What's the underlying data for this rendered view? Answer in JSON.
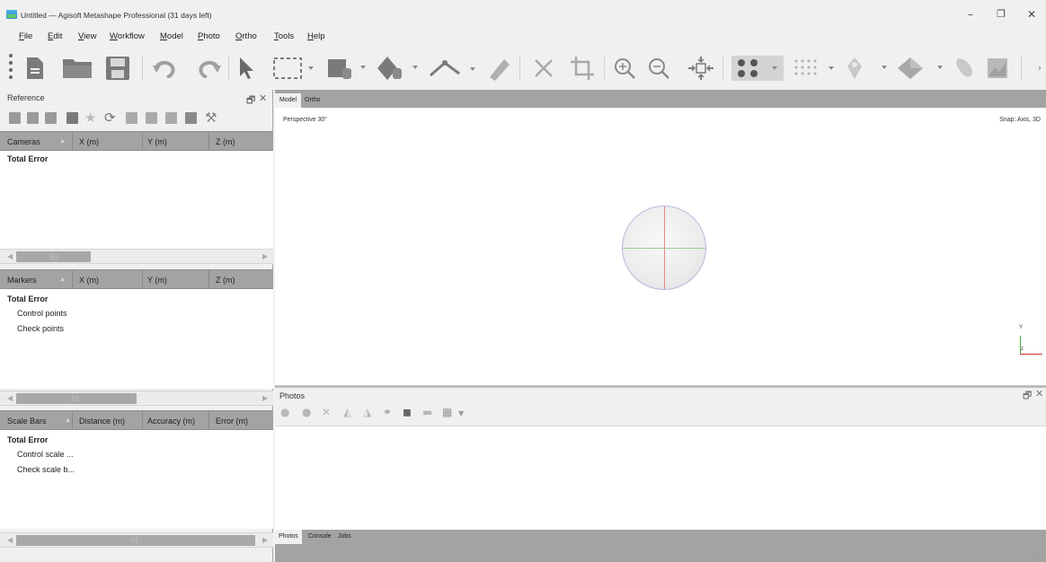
{
  "window": {
    "title": "Untitled — Agisoft Metashape Professional (31 days left)",
    "minimize": "–",
    "maximize": "❐",
    "close": "✕"
  },
  "menu": [
    {
      "label": "File",
      "key": "F",
      "rest": "ile"
    },
    {
      "label": "Edit",
      "key": "E",
      "rest": "dit"
    },
    {
      "label": "View",
      "key": "V",
      "rest": "iew"
    },
    {
      "label": "Workflow",
      "key": "W",
      "rest": "orkflow"
    },
    {
      "label": "Model",
      "key": "M",
      "rest": "odel"
    },
    {
      "label": "Photo",
      "key": "P",
      "rest": "hoto"
    },
    {
      "label": "Ortho",
      "key": "O",
      "rest": "rtho"
    },
    {
      "label": "Tools",
      "key": "T",
      "rest": "ools"
    },
    {
      "label": "Help",
      "key": "H",
      "rest": "elp"
    }
  ],
  "toolbar": {
    "icons": [
      "new-document-icon",
      "open-folder-icon",
      "save-icon",
      "undo-icon",
      "redo-icon",
      "navigation-arrow-icon",
      "rectangle-selection-icon",
      "resize-region-icon",
      "rotate-region-icon",
      "ruler-icon",
      "measure-icon",
      "delete-selection-icon",
      "crop-selection-icon",
      "zoom-in-icon",
      "zoom-out-icon",
      "reset-view-icon",
      "show-cameras-icon",
      "point-cloud-icon",
      "tie-points-icon",
      "model-shaded-icon",
      "tiled-model-icon",
      "ortho-icon"
    ]
  },
  "reference": {
    "title": "Reference",
    "float": "🗗",
    "close": "✕",
    "cameras_header": {
      "name": "Cameras",
      "x": "X (m)",
      "y": "Y (m)",
      "z": "Z (m)"
    },
    "cameras_rows": [
      "Total Error"
    ],
    "markers_header": {
      "name": "Markers",
      "x": "X (m)",
      "y": "Y (m)",
      "z": "Z (m)"
    },
    "markers_rows": {
      "total": "Total Error",
      "control": "Control points",
      "check": "Check points"
    },
    "scalebars_header": {
      "name": "Scale Bars",
      "distance": "Distance (m)",
      "accuracy": "Accuracy (m)",
      "error": "Error (m)"
    },
    "scalebars_rows": {
      "total": "Total Error",
      "control": "Control scale ...",
      "check": "Check scale b..."
    }
  },
  "model_view": {
    "tabs": [
      "Model",
      "Ortho"
    ],
    "projection": "Perspective 30°",
    "snap": "Snap: Axis, 3D",
    "axis_y": "Y",
    "axis_z": "z"
  },
  "photos": {
    "title": "Photos",
    "float": "🗗",
    "close": "✕",
    "bottom_tabs": [
      "Photos",
      "Console",
      "Jobs"
    ]
  }
}
